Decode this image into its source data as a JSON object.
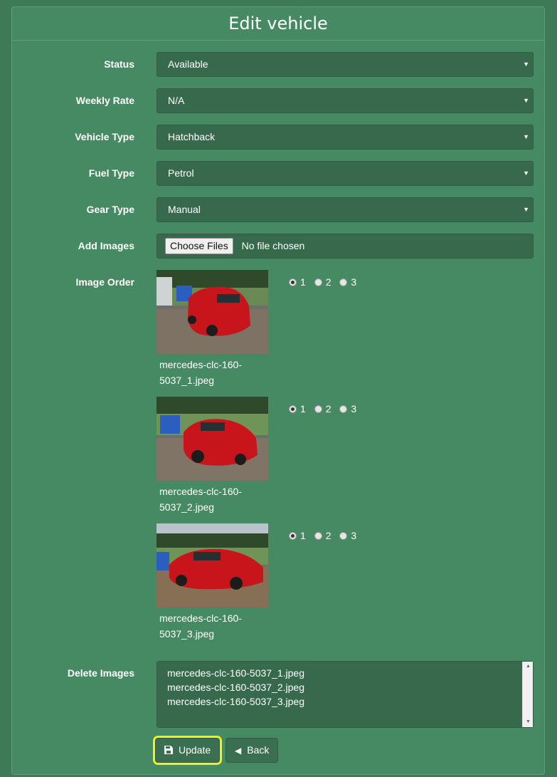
{
  "page": {
    "title": "Edit vehicle"
  },
  "form": {
    "status": {
      "label": "Status",
      "value": "Available"
    },
    "weekly_rate": {
      "label": "Weekly Rate",
      "value": "N/A"
    },
    "vehicle_type": {
      "label": "Vehicle Type",
      "value": "Hatchback"
    },
    "fuel_type": {
      "label": "Fuel Type",
      "value": "Petrol"
    },
    "gear_type": {
      "label": "Gear Type",
      "value": "Manual"
    },
    "add_images": {
      "label": "Add Images",
      "button": "Choose Files",
      "status": "No file chosen"
    },
    "image_order": {
      "label": "Image Order",
      "options": [
        "1",
        "2",
        "3"
      ],
      "images": [
        {
          "name_line1": "mercedes-clc-160-",
          "name_line2": "5037_1.jpeg",
          "selected": "1"
        },
        {
          "name_line1": "mercedes-clc-160-",
          "name_line2": "5037_2.jpeg",
          "selected": "1"
        },
        {
          "name_line1": "mercedes-clc-160-",
          "name_line2": "5037_3.jpeg",
          "selected": "1"
        }
      ]
    },
    "delete_images": {
      "label": "Delete Images",
      "items": [
        "mercedes-clc-160-5037_1.jpeg",
        "mercedes-clc-160-5037_2.jpeg",
        "mercedes-clc-160-5037_3.jpeg"
      ]
    }
  },
  "actions": {
    "update": "Update",
    "back": "Back"
  },
  "icons": {
    "select_caret": "caret-down-icon",
    "update": "floppy-disk-icon",
    "back": "caret-left-icon"
  },
  "colors": {
    "background": "#3f7a57",
    "panel": "#468a63",
    "control": "#376a4d",
    "highlight": "#f2ee20"
  }
}
